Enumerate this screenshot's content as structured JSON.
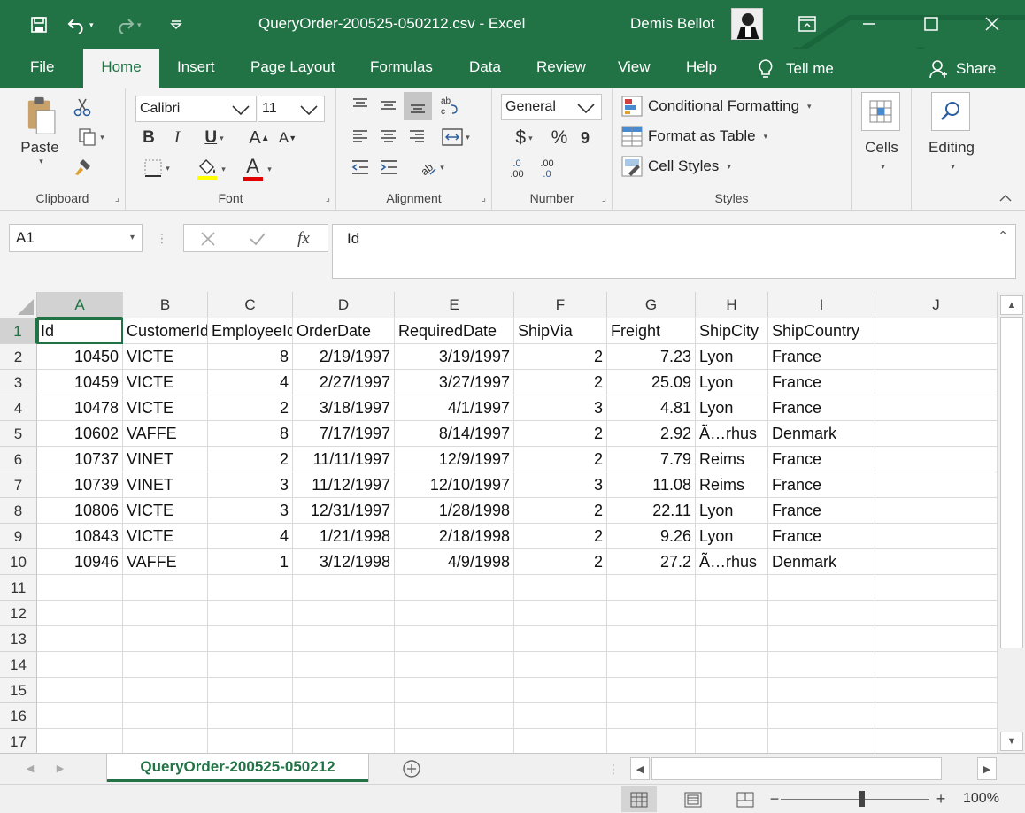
{
  "window": {
    "title": "QueryOrder-200525-050212.csv  -  Excel",
    "user": "Demis Bellot"
  },
  "tabs": [
    "File",
    "Home",
    "Insert",
    "Page Layout",
    "Formulas",
    "Data",
    "Review",
    "View",
    "Help"
  ],
  "active_tab": "Home",
  "tell_me": "Tell me",
  "share": "Share",
  "ribbon": {
    "clipboard": {
      "label": "Clipboard",
      "paste": "Paste"
    },
    "font": {
      "label": "Font",
      "name": "Calibri",
      "size": "11",
      "bold": "B",
      "italic": "I",
      "underline": "U",
      "grow": "A",
      "shrink": "A",
      "fontcolor": "A"
    },
    "alignment": {
      "label": "Alignment"
    },
    "number": {
      "label": "Number",
      "format": "General",
      "currency": "$",
      "percent": "%",
      "comma": "9",
      "inc_dec_a": ".0",
      "inc_dec_b": ".00",
      "inc_dec_c": ".00",
      "inc_dec_d": ".0"
    },
    "styles": {
      "label": "Styles",
      "conditional": "Conditional Formatting",
      "format_table": "Format as Table",
      "cell_styles": "Cell Styles"
    },
    "cells": {
      "label": "Cells"
    },
    "editing": {
      "label": "Editing"
    }
  },
  "formula_bar": {
    "name_box": "A1",
    "content": "Id",
    "fx": "fx"
  },
  "columns": [
    "A",
    "B",
    "C",
    "D",
    "E",
    "F",
    "G",
    "H",
    "I",
    "J"
  ],
  "rows": [
    "1",
    "2",
    "3",
    "4",
    "5",
    "6",
    "7",
    "8",
    "9",
    "10",
    "11",
    "12",
    "13",
    "14",
    "15",
    "16",
    "17"
  ],
  "cells": [
    [
      "Id",
      "CustomerId",
      "EmployeeId",
      "OrderDate",
      "RequiredDate",
      "ShipVia",
      "Freight",
      "ShipCity",
      "ShipCountry",
      ""
    ],
    [
      "10450",
      "VICTE",
      "8",
      "2/19/1997",
      "3/19/1997",
      "2",
      "7.23",
      "Lyon",
      "France",
      ""
    ],
    [
      "10459",
      "VICTE",
      "4",
      "2/27/1997",
      "3/27/1997",
      "2",
      "25.09",
      "Lyon",
      "France",
      ""
    ],
    [
      "10478",
      "VICTE",
      "2",
      "3/18/1997",
      "4/1/1997",
      "3",
      "4.81",
      "Lyon",
      "France",
      ""
    ],
    [
      "10602",
      "VAFFE",
      "8",
      "7/17/1997",
      "8/14/1997",
      "2",
      "2.92",
      "Ã…rhus",
      "Denmark",
      ""
    ],
    [
      "10737",
      "VINET",
      "2",
      "11/11/1997",
      "12/9/1997",
      "2",
      "7.79",
      "Reims",
      "France",
      ""
    ],
    [
      "10739",
      "VINET",
      "3",
      "11/12/1997",
      "12/10/1997",
      "3",
      "11.08",
      "Reims",
      "France",
      ""
    ],
    [
      "10806",
      "VICTE",
      "3",
      "12/31/1997",
      "1/28/1998",
      "2",
      "22.11",
      "Lyon",
      "France",
      ""
    ],
    [
      "10843",
      "VICTE",
      "4",
      "1/21/1998",
      "2/18/1998",
      "2",
      "9.26",
      "Lyon",
      "France",
      ""
    ],
    [
      "10946",
      "VAFFE",
      "1",
      "3/12/1998",
      "4/9/1998",
      "2",
      "27.2",
      "Ã…rhus",
      "Denmark",
      ""
    ]
  ],
  "sheet_tab": "QueryOrder-200525-050212",
  "zoom": "100%",
  "colors": {
    "excel_green": "#217346"
  }
}
